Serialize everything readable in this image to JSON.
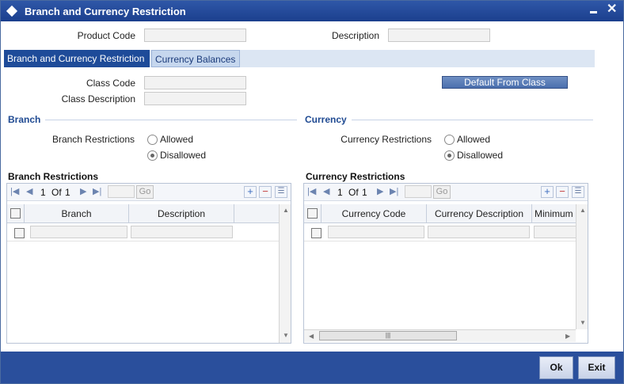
{
  "window": {
    "title": "Branch and Currency Restriction"
  },
  "header": {
    "product_code_label": "Product Code",
    "product_code_value": "",
    "description_label": "Description",
    "description_value": ""
  },
  "tabs": [
    {
      "label": "Branch and Currency Restriction",
      "active": true
    },
    {
      "label": "Currency Balances",
      "active": false
    }
  ],
  "class": {
    "class_code_label": "Class Code",
    "class_code_value": "",
    "class_description_label": "Class Description",
    "class_description_value": "",
    "default_button": "Default From Class"
  },
  "branch": {
    "section_title": "Branch",
    "restrictions_label": "Branch Restrictions",
    "options": [
      "Allowed",
      "Disallowed"
    ],
    "selected": "Disallowed"
  },
  "currency": {
    "section_title": "Currency",
    "restrictions_label": "Currency Restrictions",
    "options": [
      "Allowed",
      "Disallowed"
    ],
    "selected": "Disallowed"
  },
  "branch_grid": {
    "title": "Branch Restrictions",
    "page_current": "1",
    "page_of": "Of",
    "page_total": "1",
    "go_label": "Go",
    "columns": [
      "Branch",
      "Description"
    ]
  },
  "currency_grid": {
    "title": "Currency Restrictions",
    "page_current": "1",
    "page_of": "Of",
    "page_total": "1",
    "go_label": "Go",
    "columns": [
      "Currency Code",
      "Currency Description",
      "Minimum"
    ]
  },
  "footer": {
    "ok_label": "Ok",
    "exit_label": "Exit"
  },
  "colors": {
    "titlebar": "#1b3f8e",
    "accent": "#1e4b99",
    "section": "#1f4a92"
  }
}
